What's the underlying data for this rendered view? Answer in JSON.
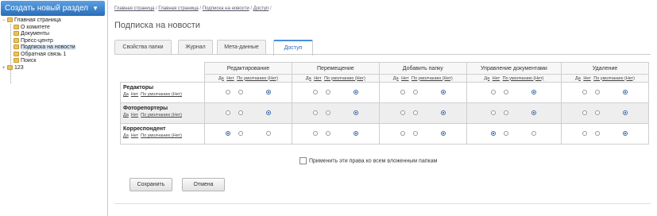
{
  "sidebar": {
    "create_label": "Создать новый раздел",
    "tree": [
      {
        "label": "Главная страница",
        "level": 0,
        "toggle": "−"
      },
      {
        "label": "О комитете",
        "level": 1
      },
      {
        "label": "Документы",
        "level": 1
      },
      {
        "label": "Пресс-центр",
        "level": 1
      },
      {
        "label": "Подписка на новости",
        "level": 1,
        "selected": true
      },
      {
        "label": "Обратная связь 1",
        "level": 1
      },
      {
        "label": "Поиск",
        "level": 1
      },
      {
        "label": "123",
        "level": 0,
        "toggle": "+"
      }
    ]
  },
  "breadcrumbs": [
    "Главная страница",
    "Главная страница",
    "Подписка на новости",
    "Доступ"
  ],
  "page_title": "Подписка на новости",
  "tabs": [
    {
      "label": "Свойства папки"
    },
    {
      "label": "Журнал"
    },
    {
      "label": "Мета-данные"
    },
    {
      "label": "Доступ",
      "active": true
    }
  ],
  "permissions": {
    "columns": [
      "Редактирование",
      "Перемещение",
      "Добавить папку",
      "Управление документами",
      "Удаление"
    ],
    "option_labels": {
      "yes": "Да",
      "no": "Нет",
      "default": "По умолчанию (Нет)"
    },
    "rows": [
      {
        "name": "Редакторы",
        "values": [
          "default",
          "default",
          "default",
          "default",
          "default"
        ]
      },
      {
        "name": "Фоторепортеры",
        "values": [
          "default",
          "default",
          "default",
          "default",
          "default"
        ]
      },
      {
        "name": "Корреспондент",
        "values": [
          "yes",
          "default",
          "default",
          "yes",
          "default"
        ]
      }
    ]
  },
  "apply_label": "Применить эти права ко всем вложенным папкам",
  "buttons": {
    "save": "Сохранить",
    "cancel": "Отмена"
  }
}
